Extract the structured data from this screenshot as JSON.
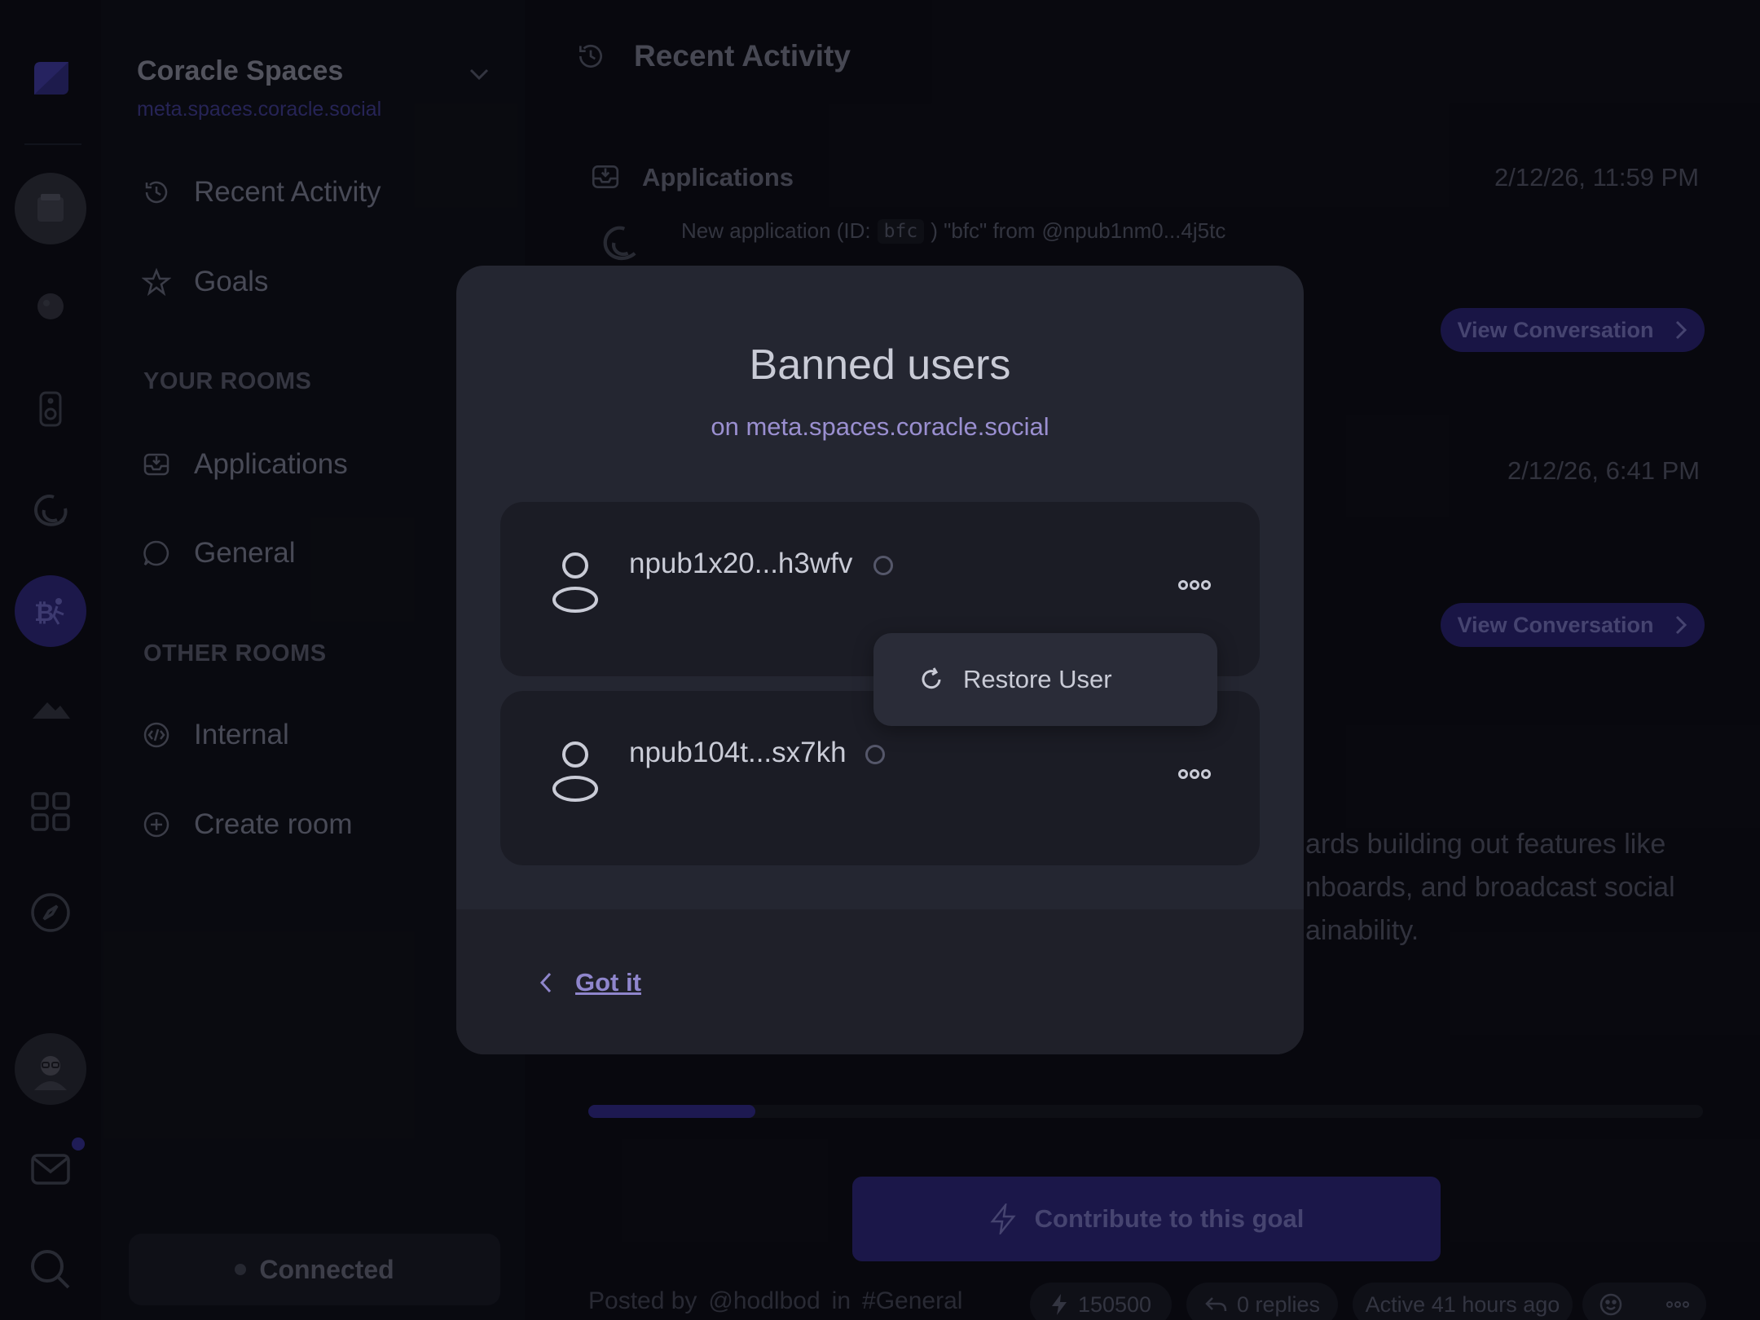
{
  "space": {
    "name": "Coracle Spaces",
    "url": "meta.spaces.coracle.social"
  },
  "sidebar": {
    "nav": [
      {
        "label": "Recent Activity",
        "icon": "history-icon"
      },
      {
        "label": "Goals",
        "icon": "star-icon"
      }
    ],
    "your_rooms_heading": "YOUR ROOMS",
    "your_rooms": [
      {
        "label": "Applications",
        "icon": "inbox-icon"
      },
      {
        "label": "General",
        "icon": "chat-bubble-icon"
      }
    ],
    "other_rooms_heading": "OTHER ROOMS",
    "other_rooms": [
      {
        "label": "Internal",
        "icon": "code-icon"
      },
      {
        "label": "Create room",
        "icon": "plus-circle-icon"
      }
    ],
    "connection_status": "Connected"
  },
  "main": {
    "title": "Recent Activity",
    "activity": {
      "room": "Applications",
      "timestamp1": "2/12/26, 11:59 PM",
      "message_prefix": "New application (ID:",
      "message_id": "bfc",
      "message_suffix": ") \"bfc\" from",
      "message_author": "@npub1nm0...4j5tc",
      "timestamp2": "2/12/26, 6:41 PM",
      "view_label": "View Conversation"
    },
    "goal_text": [
      "ards building out features like",
      "nboards, and broadcast social",
      "ainability."
    ],
    "goal_progress": 0.15,
    "contribute_label": "Contribute to this goal",
    "posted_by_label": "Posted by",
    "posted_by_user": "@hodlbod",
    "posted_in_label": "in",
    "posted_in_room": "#General",
    "zaps": "150500",
    "replies": "0 replies",
    "active": "Active 41 hours ago"
  },
  "modal": {
    "title": "Banned users",
    "subtitle_prefix": "on ",
    "subtitle_url": "meta.spaces.coracle.social",
    "users": [
      {
        "name": "npub1x20...h3wfv"
      },
      {
        "name": "npub104t...sx7kh"
      }
    ],
    "context_menu": {
      "label": "Restore User"
    },
    "got_it": "Got it"
  },
  "colors": {
    "accent": "#5b4fd6",
    "modal_bg": "#242631",
    "card_bg": "#1b1c25"
  }
}
